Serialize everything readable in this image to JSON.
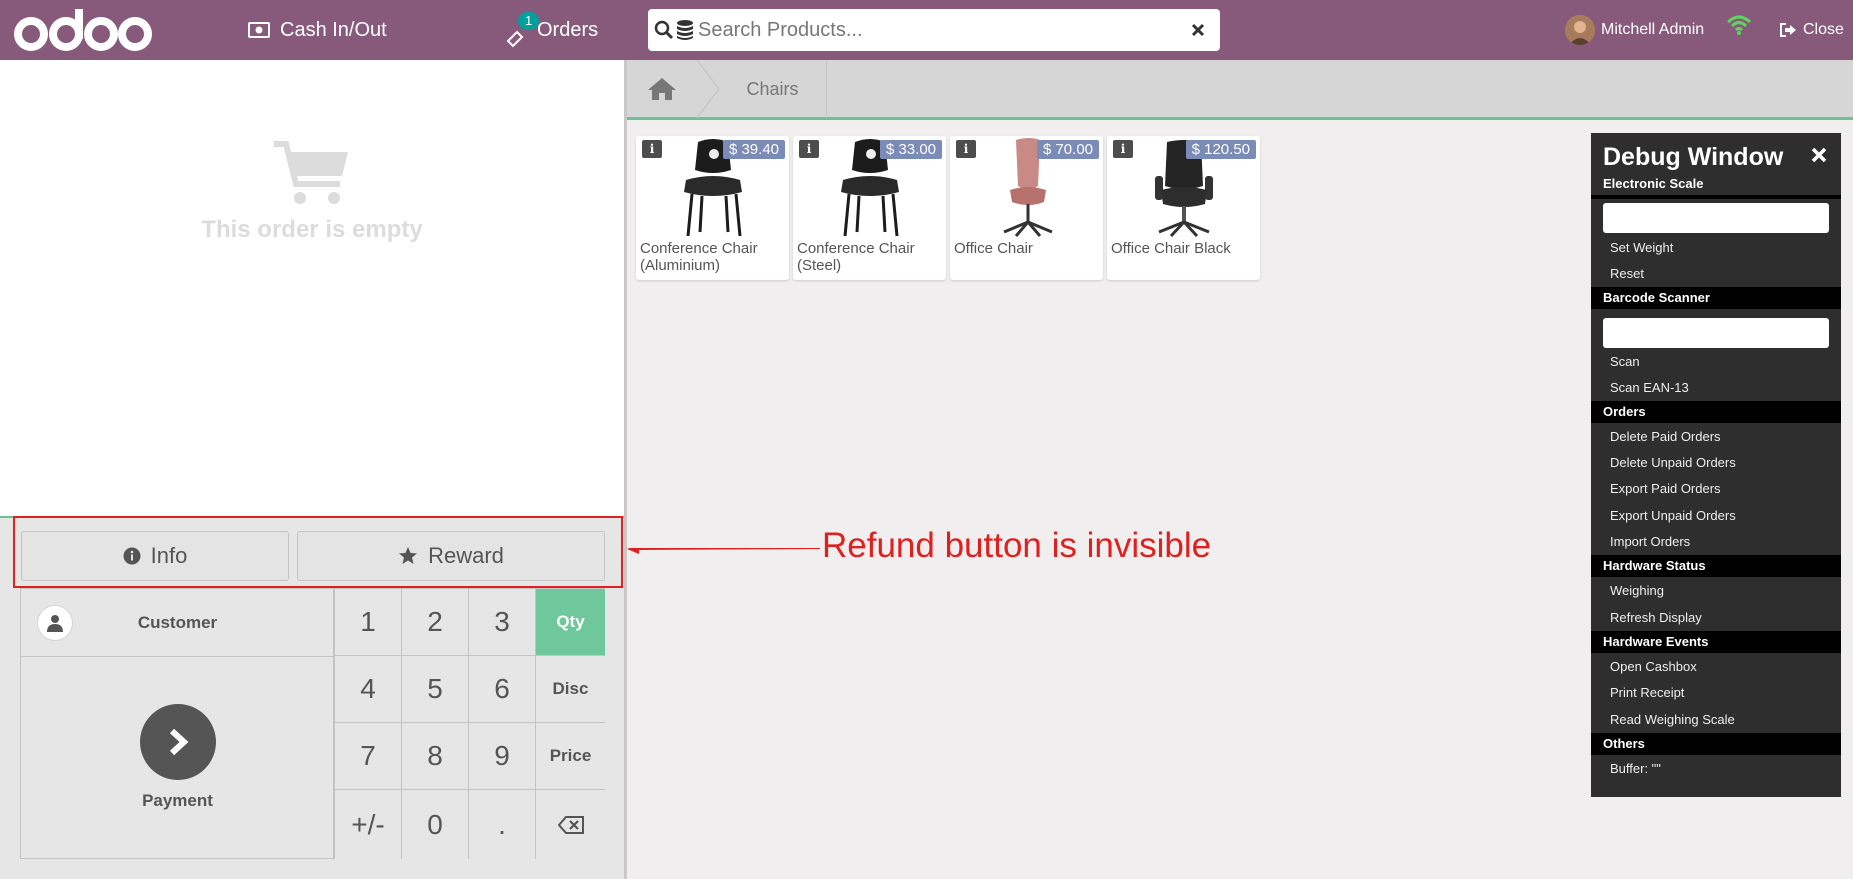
{
  "colors": {
    "brand": "#875a7b",
    "accent_green": "#6ec89b",
    "badge": "#00a09d",
    "annotation": "#e0201f"
  },
  "header": {
    "logo_text": "odoo",
    "cash_label": "Cash In/Out",
    "orders_label": "Orders",
    "orders_count": "1",
    "search_placeholder": "Search Products...",
    "user_name": "Mitchell Admin",
    "close_label": "Close"
  },
  "order": {
    "empty_text": "This order is empty"
  },
  "controls": {
    "info_label": "Info",
    "reward_label": "Reward"
  },
  "pad": {
    "customer_label": "Customer",
    "payment_label": "Payment",
    "keys": [
      "1",
      "2",
      "3",
      "Qty",
      "4",
      "5",
      "6",
      "Disc",
      "7",
      "8",
      "9",
      "Price",
      "+/-",
      "0",
      "."
    ],
    "active_mode": "Qty"
  },
  "breadcrumb": {
    "category": "Chairs"
  },
  "products": [
    {
      "name": "Conference Chair (Aluminium)",
      "price": "$ 39.40",
      "color": "#1c1c1c"
    },
    {
      "name": "Conference Chair (Steel)",
      "price": "$ 33.00",
      "color": "#1c1c1c"
    },
    {
      "name": "Office Chair",
      "price": "$ 70.00",
      "color": "#c98a86"
    },
    {
      "name": "Office Chair Black",
      "price": "$ 120.50",
      "color": "#242424"
    }
  ],
  "debug": {
    "title": "Debug Window",
    "sections": {
      "scale": "Electronic Scale",
      "barcode": "Barcode Scanner",
      "orders": "Orders",
      "hw_status": "Hardware Status",
      "hw_events": "Hardware Events",
      "others": "Others"
    },
    "links": {
      "set_weight": "Set Weight",
      "reset": "Reset",
      "scan": "Scan",
      "scan_ean": "Scan EAN-13",
      "delete_paid": "Delete Paid Orders",
      "delete_unpaid": "Delete Unpaid Orders",
      "export_paid": "Export Paid Orders",
      "export_unpaid": "Export Unpaid Orders",
      "import_orders": "Import Orders",
      "weighing": "Weighing",
      "refresh_display": "Refresh Display",
      "open_cashbox": "Open Cashbox",
      "print_receipt": "Print Receipt",
      "read_scale": "Read Weighing Scale",
      "buffer": "Buffer: \"\""
    }
  },
  "annotation": {
    "text": "Refund button is invisible"
  }
}
